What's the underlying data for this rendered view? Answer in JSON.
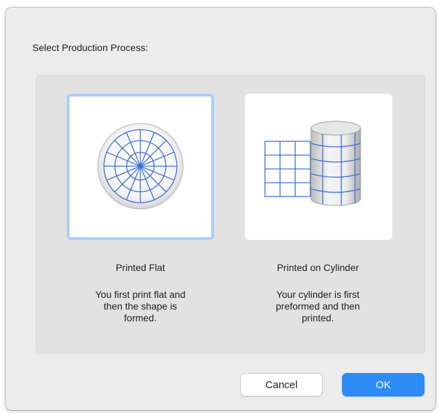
{
  "dialog": {
    "title": "Select Production Process:"
  },
  "options": [
    {
      "label": "Printed Flat",
      "description": "You first print flat and\nthen the shape is\nformed.",
      "icon": "flat-disc-grid-icon",
      "selected": true
    },
    {
      "label": "Printed on Cylinder",
      "description": "Your cylinder is first\npreformed and then\nprinted.",
      "icon": "cylinder-grid-icon",
      "selected": false
    }
  ],
  "buttons": {
    "cancel_label": "Cancel",
    "ok_label": "OK"
  },
  "colors": {
    "accent": "#2d8cf8",
    "selection_border": "#a9cdf9",
    "grid_line": "#3a6fd6"
  }
}
